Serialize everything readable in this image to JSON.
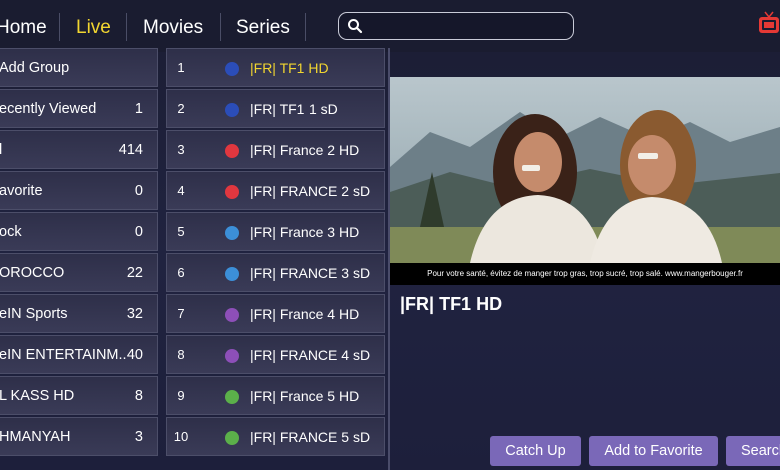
{
  "nav": {
    "home": "Home",
    "live": "Live",
    "movies": "Movies",
    "series": "Series"
  },
  "search": {
    "placeholder": "",
    "icon": "search-icon"
  },
  "groups": [
    {
      "name": "Add Group",
      "count": ""
    },
    {
      "name": "ecently Viewed",
      "count": "1"
    },
    {
      "name": "l",
      "count": "414"
    },
    {
      "name": "avorite",
      "count": "0"
    },
    {
      "name": "ock",
      "count": "0"
    },
    {
      "name": "OROCCO",
      "count": "22"
    },
    {
      "name": "eIN Sports",
      "count": "32"
    },
    {
      "name": "eIN ENTERTAINM..",
      "count": "40"
    },
    {
      "name": "L KASS HD",
      "count": "8"
    },
    {
      "name": "HMANYAH",
      "count": "3"
    }
  ],
  "channels": [
    {
      "num": "1",
      "name": "|FR| TF1 HD",
      "icon": "tf1-logo-icon",
      "color": "#2b4db8",
      "selected": true
    },
    {
      "num": "2",
      "name": "|FR| TF1",
      "suffix": "1 sD",
      "icon": "tf1-logo-icon",
      "color": "#2b4db8"
    },
    {
      "num": "3",
      "name": "|FR| France 2 HD",
      "icon": "france2-logo-icon",
      "color": "#e0373f"
    },
    {
      "num": "4",
      "name": "|FR| FRANCE 2 sD",
      "icon": "france2-logo-icon",
      "color": "#e0373f"
    },
    {
      "num": "5",
      "name": "|FR| France 3 HD",
      "icon": "france3-logo-icon",
      "color": "#3c8fd8"
    },
    {
      "num": "6",
      "name": "|FR| FRANCE 3 sD",
      "icon": "france3-logo-icon",
      "color": "#3c8fd8"
    },
    {
      "num": "7",
      "name": "|FR| France 4 HD",
      "icon": "france4-logo-icon",
      "color": "#8d4fb8"
    },
    {
      "num": "8",
      "name": "|FR| FRANCE 4 sD",
      "icon": "france4-logo-icon",
      "color": "#8d4fb8"
    },
    {
      "num": "9",
      "name": "|FR| France 5 HD",
      "icon": "france5-logo-icon",
      "color": "#5bb04a"
    },
    {
      "num": "10",
      "name": "|FR| FRANCE 5 sD",
      "icon": "france5-logo-icon",
      "color": "#5bb04a"
    }
  ],
  "player": {
    "notice": "Pour votre santé, évitez de manger trop gras, trop sucré, trop salé. www.mangerbouger.fr",
    "now_playing": "|FR| TF1 HD"
  },
  "buttons": {
    "catch_up": "Catch Up",
    "add_favorite": "Add to Favorite",
    "search": "Search"
  },
  "colors": {
    "accent": "#f2d630",
    "button": "#7a68b8"
  }
}
